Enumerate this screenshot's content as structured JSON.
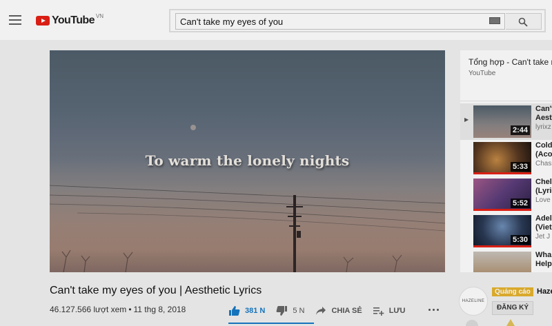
{
  "header": {
    "logo_text": "YouTube",
    "region": "VN",
    "search": {
      "value": "Can't take my eyes of you",
      "placeholder": ""
    }
  },
  "video": {
    "caption": "To warm the lonely nights",
    "title": "Can't take my eyes of you | Aesthetic Lyrics",
    "views": "46.127.566 lượt xem",
    "date": "11 thg 8, 2018",
    "likes": "381 N",
    "dislikes": "5 N",
    "share_label": "CHIA SẺ",
    "save_label": "LƯU"
  },
  "playlist": {
    "title": "Tổng hợp - Can't take m",
    "channel": "YouTube",
    "items": [
      {
        "name": "Can't",
        "name2": "Aest",
        "author": "lyrixz",
        "duration": "2:44",
        "active": true
      },
      {
        "name": "Cold",
        "name2": "(Aco",
        "author": "Chas",
        "duration": "5:33"
      },
      {
        "name": "Chel",
        "name2": "(Lyric",
        "author": "Love",
        "duration": "5:52"
      },
      {
        "name": "Adel",
        "name2": "(Viet",
        "author": "Jet J",
        "duration": "5:30"
      },
      {
        "name": "Wha",
        "name2": "Help",
        "author": "",
        "duration": ""
      }
    ]
  },
  "ad": {
    "badge": "Quảng cáo",
    "name": "Haze",
    "logo": "HAZELINE",
    "subscribe_label": "ĐĂNG KÝ"
  },
  "colors": {
    "brand_red": "#e62117",
    "like_blue": "#167ac6",
    "ad_yellow": "#e6b32e"
  }
}
